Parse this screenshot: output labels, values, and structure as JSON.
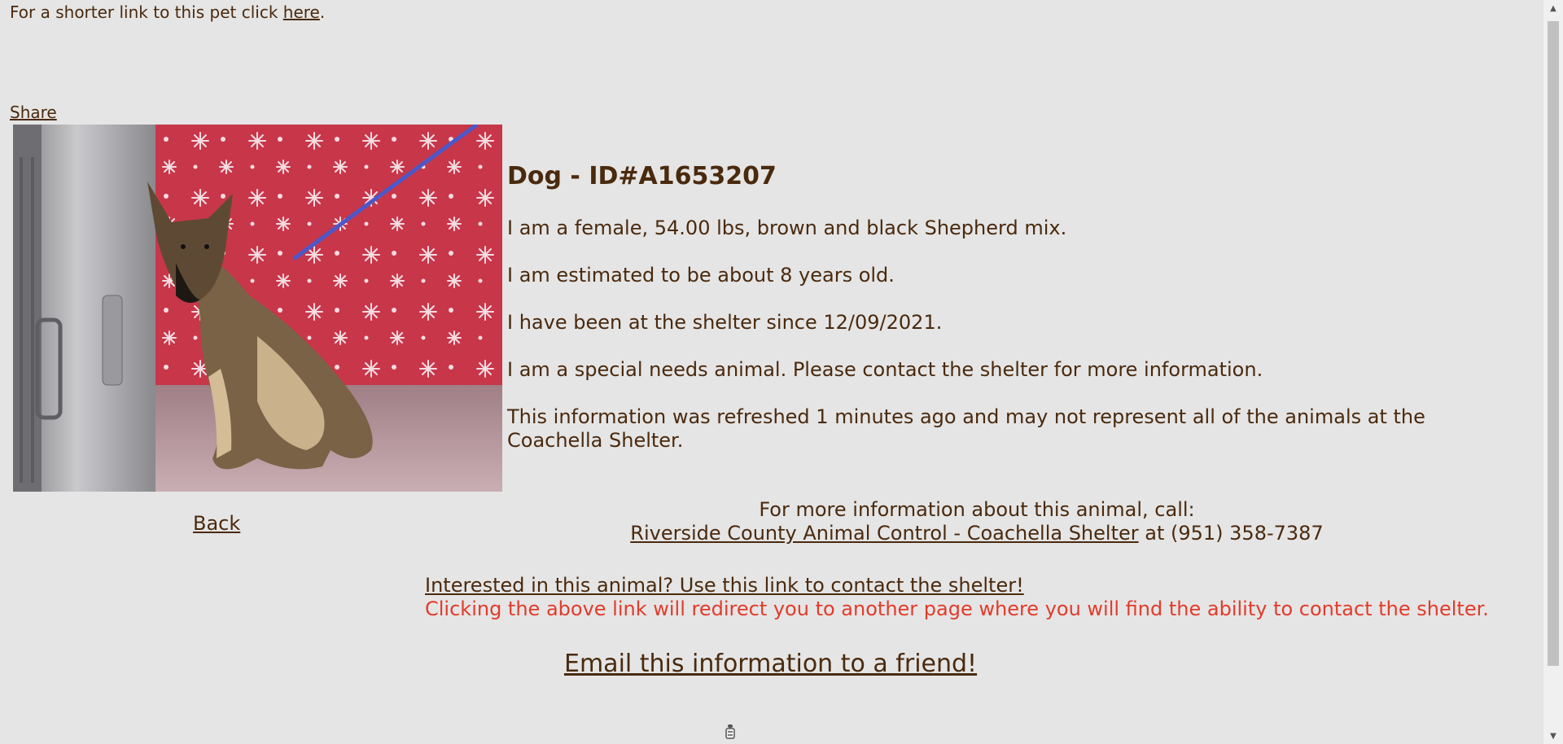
{
  "short_link": {
    "text_before": "For a shorter link to this pet click ",
    "link_text": "here",
    "text_after": "."
  },
  "share_label": "Share",
  "back_label": "Back",
  "pet": {
    "title": "Dog - ID#A1653207",
    "lines": [
      "I am a female, 54.00 lbs, brown and black Shepherd mix.",
      "I am estimated to be about 8 years old.",
      "I have been at the shelter since 12/09/2021.",
      "I am a special needs animal. Please contact the shelter for more information.",
      "This information was refreshed 1 minutes ago and may not represent all of the animals at the Coachella Shelter."
    ]
  },
  "call": {
    "prompt": "For more information about this animal, call:",
    "shelter_name": "Riverside County Animal Control - Coachella Shelter",
    "at_text": " at ",
    "phone": "(951) 358-7387"
  },
  "contact": {
    "link_text": "Interested in this animal? Use this link to contact the shelter!",
    "warning": "Clicking the above link will redirect you to another page where you will find the ability to contact the shelter."
  },
  "email_label": "Email this information to a friend!",
  "colors": {
    "background": "#e5e5e5",
    "text": "#4a2a0e",
    "warning": "#e33b2b"
  },
  "icons": [
    "dog-photo",
    "share-icon-small",
    "scroll-up-arrow-icon",
    "scroll-down-arrow-icon"
  ]
}
